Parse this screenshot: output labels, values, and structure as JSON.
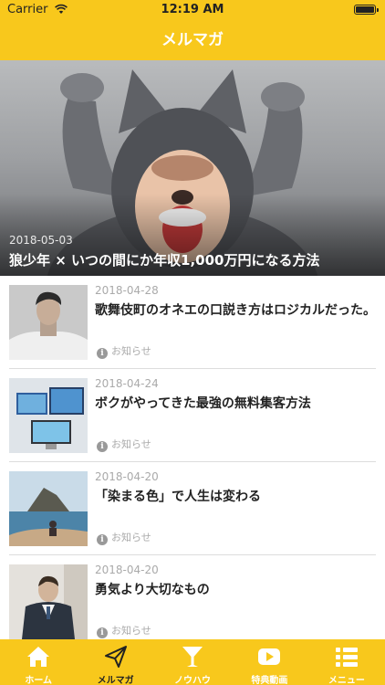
{
  "status_bar": {
    "carrier": "Carrier",
    "time": "12:19 AM"
  },
  "nav": {
    "title": "メルマガ"
  },
  "featured": {
    "date": "2018-05-03",
    "title": "狼少年 × いつの間にか年収1,000万円になる方法"
  },
  "articles": [
    {
      "date": "2018-04-28",
      "title": "歌舞伎町のオネエの口説き方はロジカルだった。",
      "category": "お知らせ"
    },
    {
      "date": "2018-04-24",
      "title": "ボクがやってきた最強の無料集客方法",
      "category": "お知らせ"
    },
    {
      "date": "2018-04-20",
      "title": "「染まる色」で人生は変わる",
      "category": "お知らせ"
    },
    {
      "date": "2018-04-20",
      "title": "勇気より大切なもの",
      "category": "お知らせ"
    }
  ],
  "tabs": [
    {
      "label": "ホーム",
      "icon": "home-icon"
    },
    {
      "label": "メルマガ",
      "icon": "paper-plane-icon"
    },
    {
      "label": "ノウハウ",
      "icon": "cocktail-glass-icon"
    },
    {
      "label": "特典動画",
      "icon": "play-video-icon"
    },
    {
      "label": "メニュー",
      "icon": "menu-list-icon"
    }
  ],
  "colors": {
    "accent": "#f8c81c",
    "tab_inactive": "#ffffff",
    "tab_active": "#222222"
  }
}
